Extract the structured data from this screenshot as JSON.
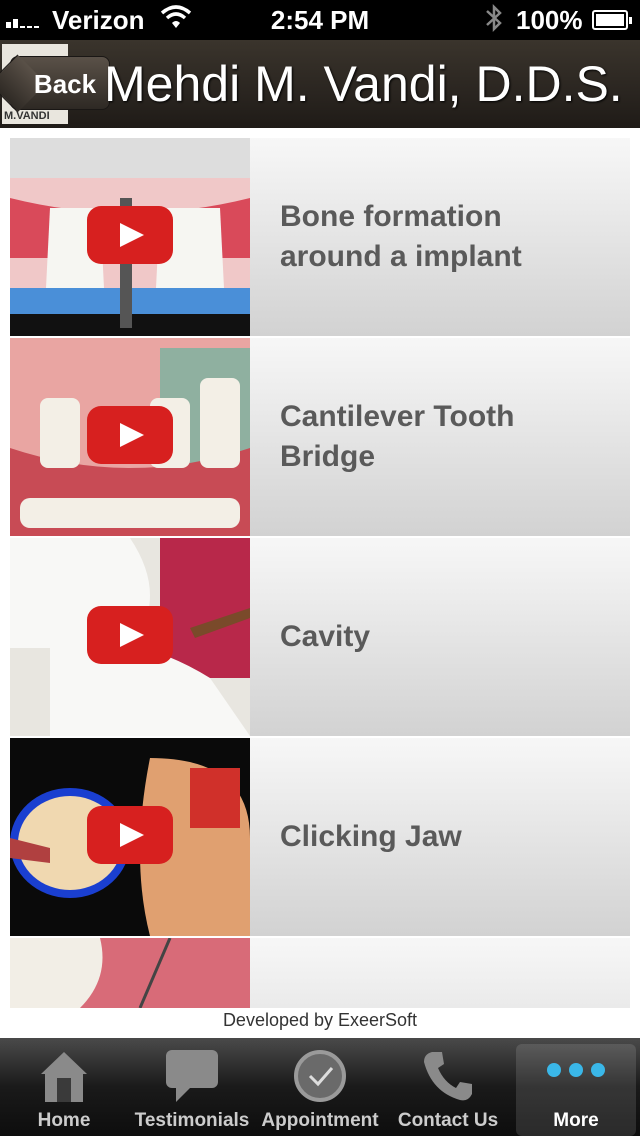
{
  "status_bar": {
    "carrier": "Verizon",
    "time": "2:54 PM",
    "battery": "100%"
  },
  "header": {
    "back_label": "Back",
    "title": "Mehdi M. Vandi, D.D.S.",
    "logo_text": "M.VANDI"
  },
  "videos": [
    {
      "line1": "Bone formation",
      "line2": "around a implant",
      "thumb_colors": [
        "#f0c8c8",
        "#d94a5a",
        "#f6f6f2"
      ]
    },
    {
      "line1": "Cantilever Tooth",
      "line2": "Bridge",
      "thumb_colors": [
        "#e9a5a2",
        "#c84b55",
        "#f3efe6"
      ]
    },
    {
      "line1": "Cavity",
      "line2": "",
      "thumb_colors": [
        "#e8e6e0",
        "#b8284a",
        "#f8f8f6"
      ]
    },
    {
      "line1": "Clicking Jaw",
      "line2": "",
      "thumb_colors": [
        "#0a0a0a",
        "#e0a070",
        "#1a3fd0"
      ]
    },
    {
      "line1": "",
      "line2": "",
      "thumb_colors": [
        "#d86b78",
        "#f2eee6",
        "#c23a4a"
      ]
    }
  ],
  "footer_credit": "Developed by ExeerSoft",
  "tabs": [
    {
      "label": "Home",
      "icon": "home-icon"
    },
    {
      "label": "Testimonials",
      "icon": "speech-bubble-icon"
    },
    {
      "label": "Appointment",
      "icon": "clock-icon"
    },
    {
      "label": "Contact Us",
      "icon": "phone-icon"
    },
    {
      "label": "More",
      "icon": "more-dots-icon"
    }
  ],
  "accent_color": "#3ab7e8",
  "play_color": "#d7201f"
}
